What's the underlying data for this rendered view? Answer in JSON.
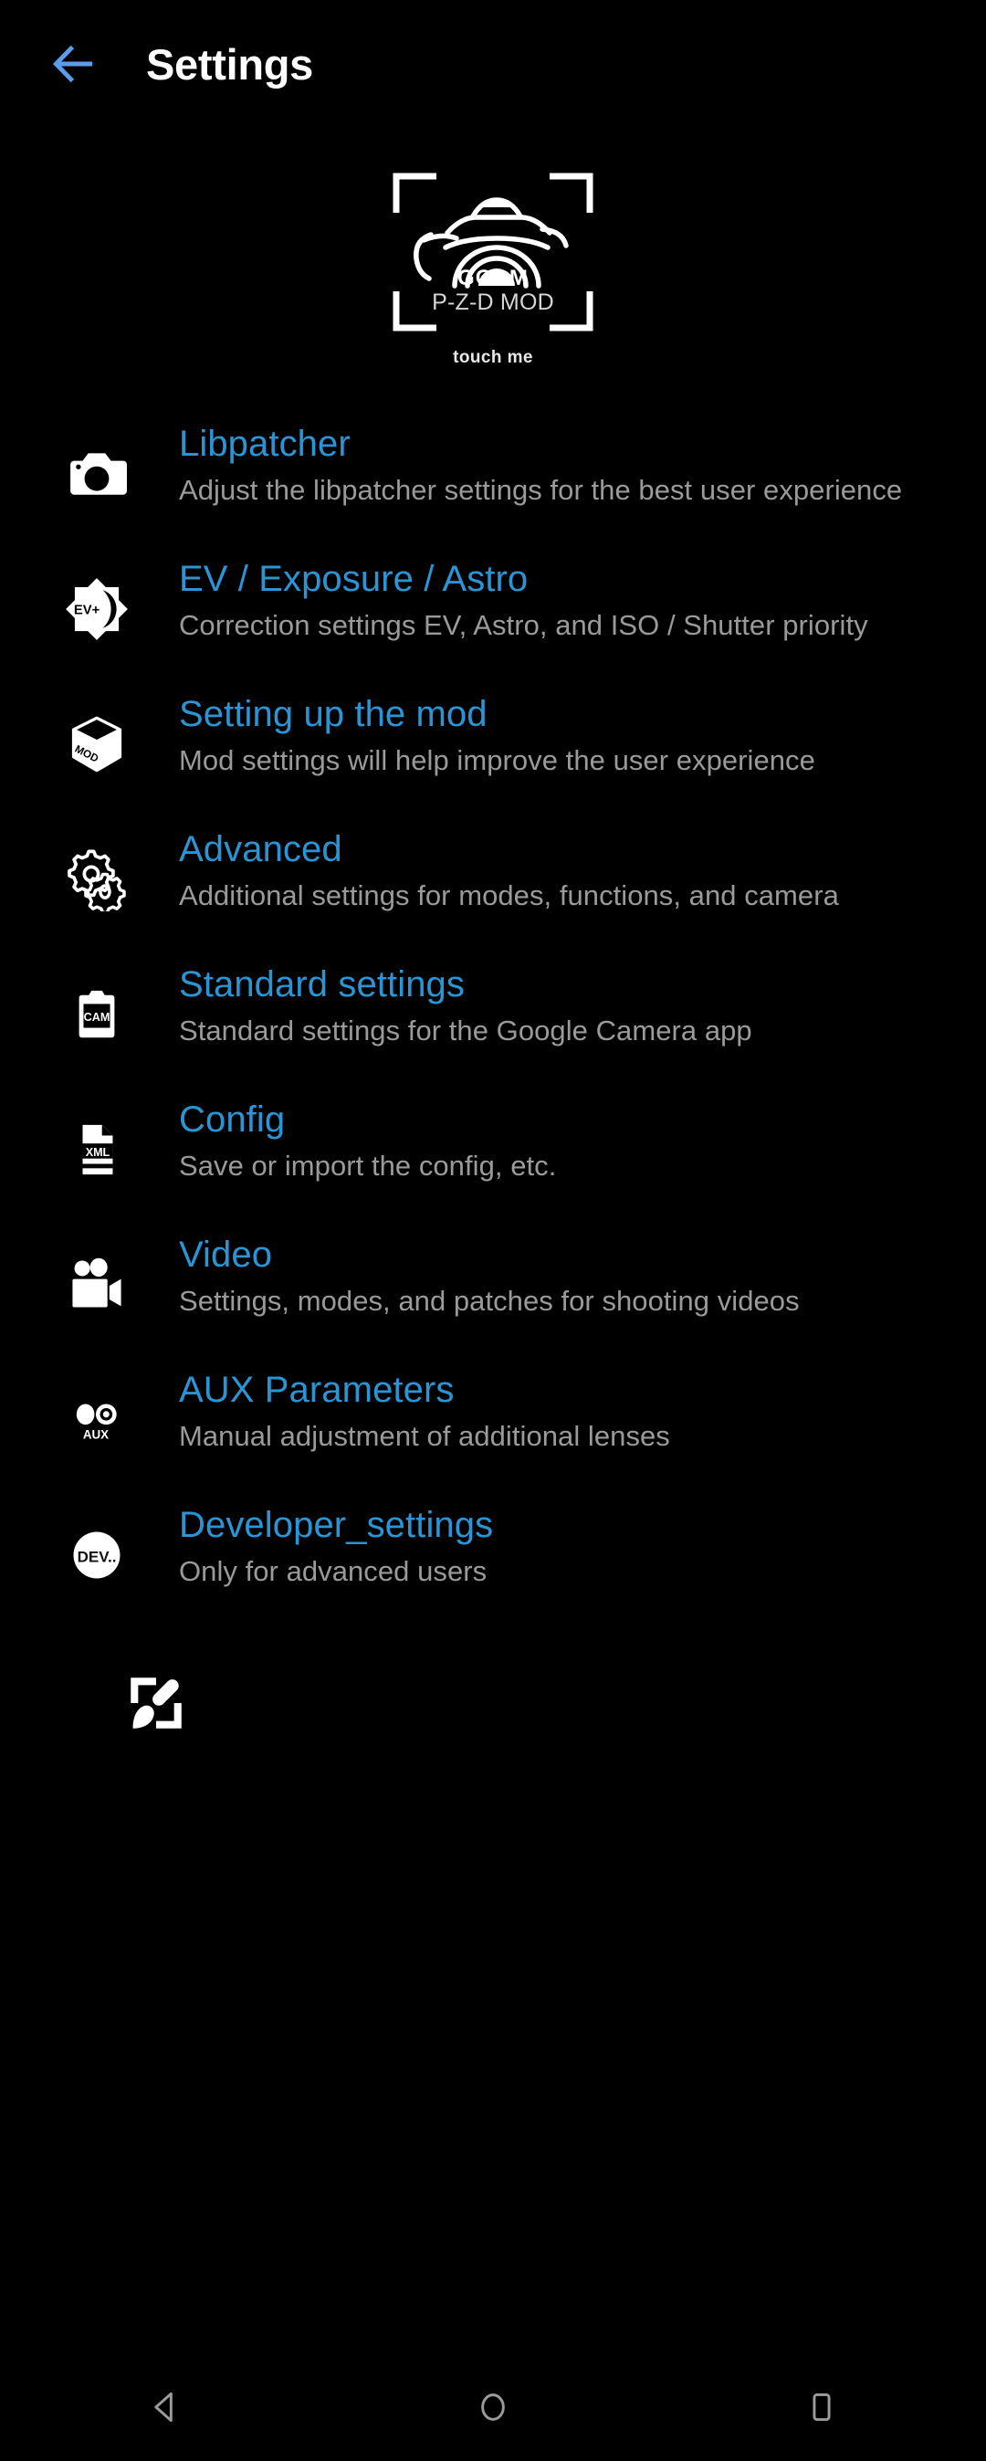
{
  "appbar": {
    "back_icon": "arrow-left-icon",
    "title": "Settings",
    "back_color": "#5c9cec",
    "title_color": "#ffffff"
  },
  "logo": {
    "brand_line1": "GCAM",
    "brand_line2": "P-Z-D MOD",
    "caption": "touch me",
    "icon": "gcam-camera-logo"
  },
  "theme": {
    "accent_blue": "#2a95d5",
    "subtitle_gray": "#9a9a9a",
    "background": "#000000"
  },
  "settings": {
    "items": [
      {
        "icon": "photo-camera-icon",
        "title": "Libpatcher",
        "subtitle": "Adjust the libpatcher settings for the best user experience"
      },
      {
        "icon": "ev-exposure-astro-icon",
        "icon_label": "EV+",
        "title": "EV / Exposure / Astro",
        "subtitle": "Correction settings EV, Astro, and ISO / Shutter priority"
      },
      {
        "icon": "mod-box-icon",
        "icon_label": "MOD",
        "title": "Setting up the mod",
        "subtitle": "Mod settings will help improve the user experience"
      },
      {
        "icon": "gears-icon",
        "title": "Advanced",
        "subtitle": "Additional settings for modes, functions, and camera"
      },
      {
        "icon": "cam-card-icon",
        "icon_label": "CAM",
        "title": "Standard settings",
        "subtitle": "Standard settings for the Google Camera app"
      },
      {
        "icon": "xml-file-icon",
        "icon_label": "XML",
        "title": "Config",
        "subtitle": "Save or import the config, etc."
      },
      {
        "icon": "video-camera-icon",
        "title": "Video",
        "subtitle": "Settings, modes, and patches for shooting videos"
      },
      {
        "icon": "aux-lenses-icon",
        "icon_label": "AUX",
        "title": "AUX Parameters",
        "subtitle": "Manual adjustment of additional lenses"
      },
      {
        "icon": "dev-circle-icon",
        "icon_label": "DEV..",
        "title": "Developer_settings",
        "subtitle": "Only for advanced users"
      }
    ]
  },
  "footer": {
    "brush_icon": "paint-brush-theme-icon"
  },
  "navbar": {
    "back_icon": "nav-back-triangle-icon",
    "home_icon": "nav-home-circle-icon",
    "recents_icon": "nav-recents-square-icon",
    "color": "#9b9b9b"
  }
}
